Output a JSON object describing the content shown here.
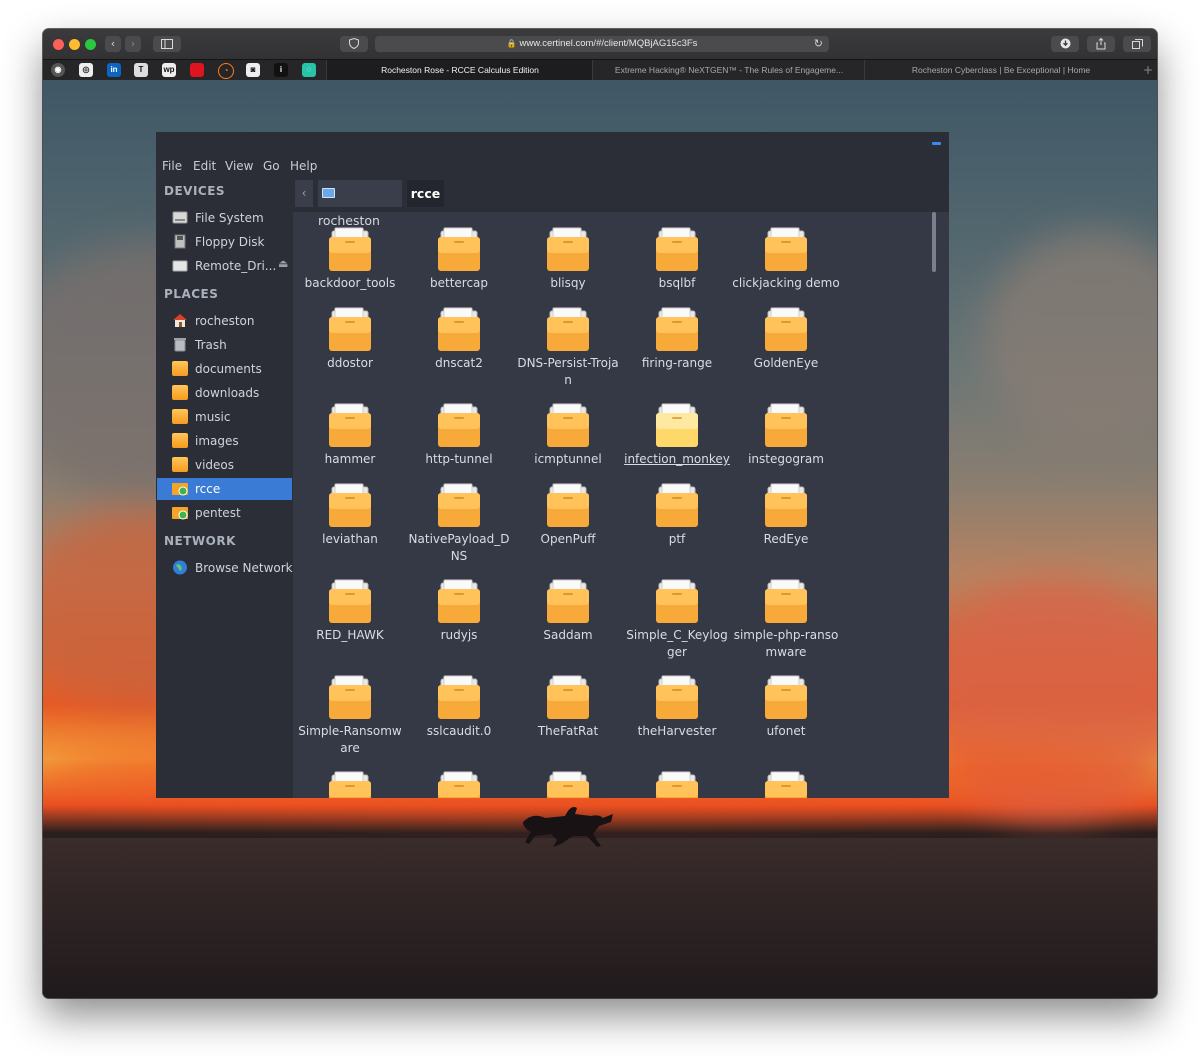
{
  "browser": {
    "url": "www.certinel.com/#/client/MQBjAG15c3Fs",
    "tabs": [
      {
        "label": "Rocheston Rose - RCCE Calculus Edition",
        "active": true
      },
      {
        "label": "Extreme Hacking® NeXTGEN™ - The Rules of Engageme...",
        "active": false
      },
      {
        "label": "Rocheston Cyberclass | Be Exceptional | Home",
        "active": false
      }
    ],
    "favorites": [
      "globe",
      "camera",
      "in",
      "T",
      "wp",
      "red",
      "rss",
      "cam",
      "i",
      "ch"
    ],
    "new_tab": "+"
  },
  "filemanager": {
    "menu": [
      "File",
      "Edit",
      "View",
      "Go",
      "Help"
    ],
    "sidebar": {
      "devices_title": "DEVICES",
      "devices": [
        {
          "label": "File System",
          "icon": "drive-icon"
        },
        {
          "label": "Floppy Disk",
          "icon": "floppy-icon"
        },
        {
          "label": "Remote_Dri...",
          "icon": "remote-drive-icon"
        }
      ],
      "eject": "⏏",
      "places_title": "PLACES",
      "places": [
        {
          "label": "rocheston",
          "icon": "home-icon"
        },
        {
          "label": "Trash",
          "icon": "trash-icon"
        },
        {
          "label": "documents",
          "icon": "folder-icon"
        },
        {
          "label": "downloads",
          "icon": "folder-icon"
        },
        {
          "label": "music",
          "icon": "folder-icon"
        },
        {
          "label": "images",
          "icon": "folder-icon"
        },
        {
          "label": "videos",
          "icon": "folder-icon"
        },
        {
          "label": "rcce",
          "icon": "folder-icon",
          "selected": true
        },
        {
          "label": "pentest",
          "icon": "folder-icon"
        }
      ],
      "network_title": "NETWORK",
      "network": [
        {
          "label": "Browse Network",
          "icon": "network-icon"
        }
      ]
    },
    "path": {
      "back": "‹",
      "crumbs": [
        "rocheston",
        "rcce"
      ]
    },
    "files": [
      "backdoor_tools",
      "bettercap",
      "blisqy",
      "bsqlbf",
      "clickjacking demo",
      "ddostor",
      "dnscat2",
      "DNS-Persist-Trojan",
      "firing-range",
      "GoldenEye",
      "hammer",
      "http-tunnel",
      "icmptunnel",
      "infection_monkey",
      "instegogram",
      "leviathan",
      "NativePayload_DNS",
      "OpenPuff",
      "ptf",
      "RedEye",
      "RED_HAWK",
      "rudyjs",
      "Saddam",
      "Simple_C_Keylogger",
      "simple-php-ransomware",
      "Simple-Ransomware",
      "sslcaudit.0",
      "TheFatRat",
      "theHarvester",
      "ufonet",
      "",
      "",
      "",
      "",
      ""
    ],
    "hovered_file": "infection_monkey"
  }
}
